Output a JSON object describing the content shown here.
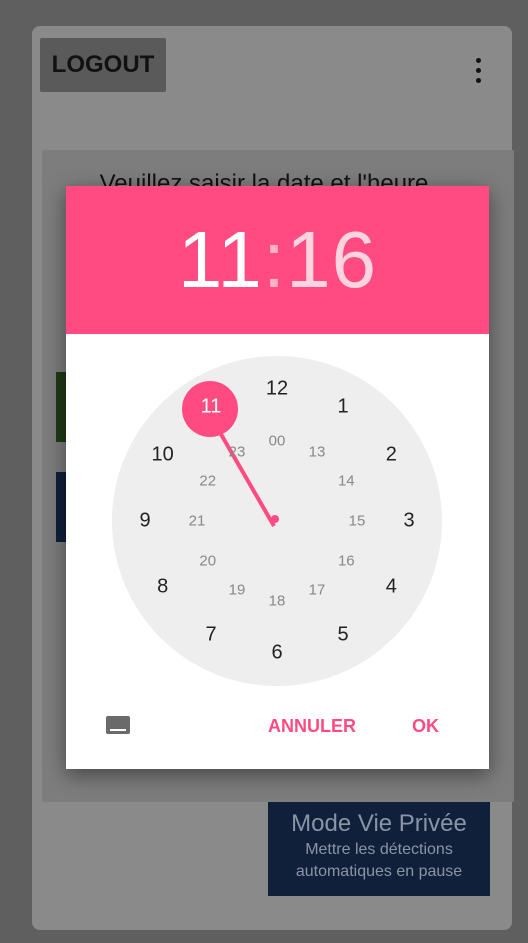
{
  "app": {
    "logout_label": "LOGOUT",
    "menu_icon": "more-vertical-icon",
    "inner_title": "Veuillez saisir la date et l'heure",
    "privacy_title": "Mode Vie Privée",
    "privacy_subtitle_line1": "Mettre les détections",
    "privacy_subtitle_line2": "automatiques en pause"
  },
  "picker": {
    "hour": "11",
    "separator": ":",
    "minute": "16",
    "selected_hour": "11",
    "outer_hours": [
      "12",
      "1",
      "2",
      "3",
      "4",
      "5",
      "6",
      "7",
      "8",
      "9",
      "10",
      "11"
    ],
    "inner_hours": [
      "00",
      "13",
      "14",
      "15",
      "16",
      "17",
      "18",
      "19",
      "20",
      "21",
      "22",
      "23"
    ],
    "actions": {
      "cancel": "ANNULER",
      "ok": "OK"
    },
    "keyboard_icon": "keyboard-icon"
  },
  "colors": {
    "accent": "#ff4b82",
    "header": "#ff4b82",
    "clock_face": "#eeeeee",
    "dim_overlay": "#5f5f5f"
  }
}
